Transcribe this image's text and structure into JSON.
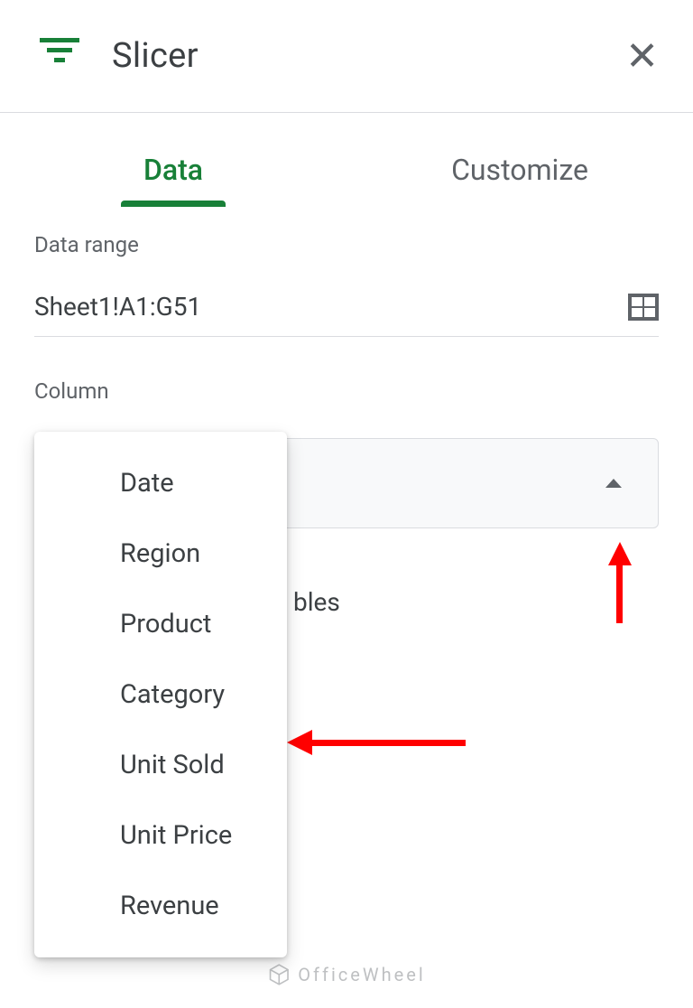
{
  "header": {
    "title": "Slicer"
  },
  "tabs": {
    "data": "Data",
    "customize": "Customize"
  },
  "data_range": {
    "label": "Data range",
    "value": "Sheet1!A1:G51"
  },
  "column": {
    "label": "Column",
    "options": [
      "Date",
      "Region",
      "Product",
      "Category",
      "Unit Sold",
      "Unit Price",
      "Revenue"
    ]
  },
  "partial_text": "bles",
  "watermark": "OfficeWheel"
}
